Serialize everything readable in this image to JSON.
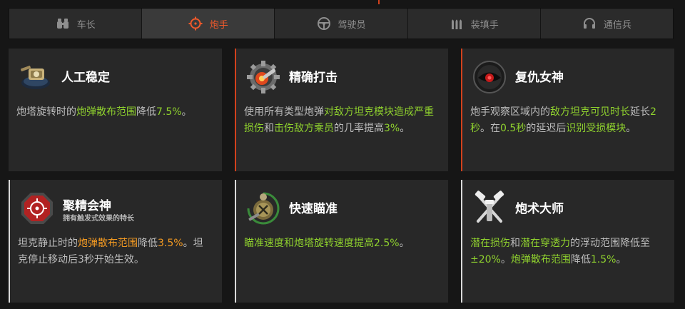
{
  "tabs": [
    {
      "label": "车长",
      "icon": "binoculars-icon",
      "active": false
    },
    {
      "label": "炮手",
      "icon": "crosshair-icon",
      "active": true
    },
    {
      "label": "驾驶员",
      "icon": "steering-wheel-icon",
      "active": false
    },
    {
      "label": "装填手",
      "icon": "shells-icon",
      "active": false
    },
    {
      "label": "通信兵",
      "icon": "headphones-icon",
      "active": false
    }
  ],
  "colors": {
    "accent": "#f0592b",
    "highlight_green": "#8fd12e",
    "highlight_orange": "#f39a22"
  },
  "skills": [
    {
      "title": "人工稳定",
      "icon": "stabilizer-icon",
      "desc": [
        {
          "t": "炮塔旋转时的",
          "c": ""
        },
        {
          "t": "炮弹散布范围",
          "c": "g"
        },
        {
          "t": "降低",
          "c": ""
        },
        {
          "t": "7.5%",
          "c": "g"
        },
        {
          "t": "。",
          "c": ""
        }
      ]
    },
    {
      "title": "精确打击",
      "icon": "precision-strike-icon",
      "desc": [
        {
          "t": "使用所有类型炮弹",
          "c": ""
        },
        {
          "t": "对敌方坦克模块造成严重损伤",
          "c": "g"
        },
        {
          "t": "和",
          "c": ""
        },
        {
          "t": "击伤敌方乘员",
          "c": "g"
        },
        {
          "t": "的几率提高",
          "c": ""
        },
        {
          "t": "3%",
          "c": "g"
        },
        {
          "t": "。",
          "c": ""
        }
      ]
    },
    {
      "title": "复仇女神",
      "icon": "nemesis-eye-icon",
      "desc": [
        {
          "t": "炮手观察区域内的",
          "c": ""
        },
        {
          "t": "敌方坦克可见时长",
          "c": "g"
        },
        {
          "t": "延长",
          "c": ""
        },
        {
          "t": "2秒",
          "c": "g"
        },
        {
          "t": "。在",
          "c": ""
        },
        {
          "t": "0.5秒",
          "c": "g"
        },
        {
          "t": "的延迟后",
          "c": ""
        },
        {
          "t": "识别受损模块",
          "c": "g"
        },
        {
          "t": "。",
          "c": ""
        }
      ]
    },
    {
      "title": "聚精会神",
      "subtitle": "拥有触发式效果的特长",
      "icon": "focus-target-icon",
      "desc": [
        {
          "t": "坦克静止时的",
          "c": ""
        },
        {
          "t": "炮弹散布范围",
          "c": "o"
        },
        {
          "t": "降低",
          "c": ""
        },
        {
          "t": "3.5%",
          "c": "o"
        },
        {
          "t": "。坦克停止移动后3秒开始生效。",
          "c": ""
        }
      ]
    },
    {
      "title": "快速瞄准",
      "icon": "quick-aim-icon",
      "desc": [
        {
          "t": "瞄准速度和炮塔旋转速度提高",
          "c": "g"
        },
        {
          "t": "2.5%",
          "c": "g"
        },
        {
          "t": "。",
          "c": ""
        }
      ]
    },
    {
      "title": "炮术大师",
      "icon": "crossed-tools-icon",
      "desc": [
        {
          "t": "潜在损伤",
          "c": "g"
        },
        {
          "t": "和",
          "c": ""
        },
        {
          "t": "潜在穿透力",
          "c": "g"
        },
        {
          "t": "的浮动范围降低至",
          "c": ""
        },
        {
          "t": "±20%",
          "c": "g"
        },
        {
          "t": "。",
          "c": ""
        },
        {
          "t": "炮弹散布范围",
          "c": "g"
        },
        {
          "t": "降低",
          "c": ""
        },
        {
          "t": "1.5%",
          "c": "g"
        },
        {
          "t": "。",
          "c": ""
        }
      ]
    }
  ]
}
